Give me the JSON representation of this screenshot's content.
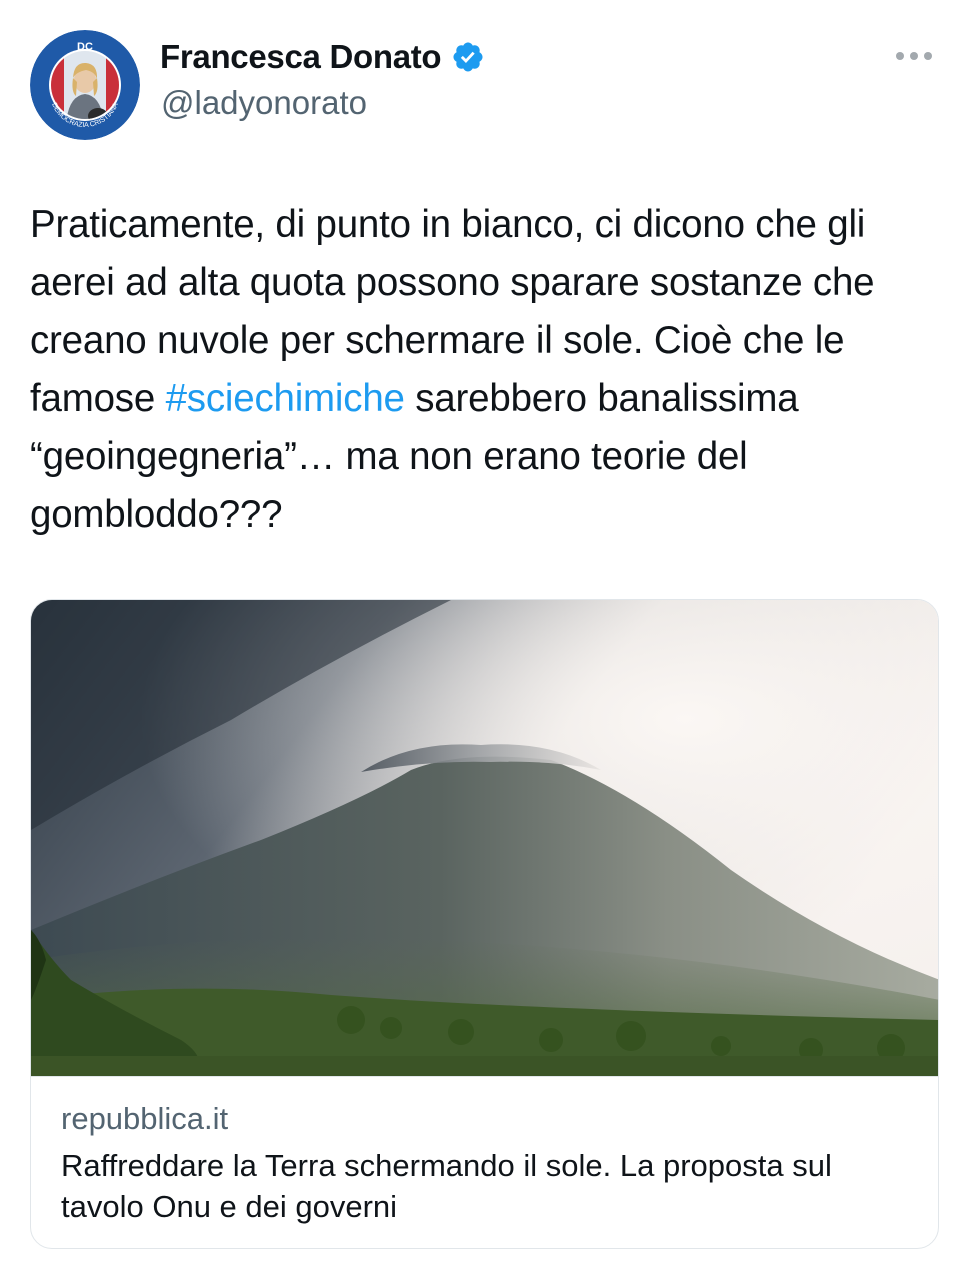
{
  "author": {
    "display_name": "Francesca Donato",
    "handle": "@ladyonorato",
    "avatar_badge_text": "DC",
    "avatar_ring_text": "DEMOCRAZIA CRISTIANA",
    "verified": true
  },
  "tweet": {
    "text_before_hashtag": "Praticamente, di punto in bianco, ci dicono che gli aerei ad alta quota possono sparare sostanze che creano nuvole per schermare il sole. Cioè che le famose ",
    "hashtag": "#sciechimiche",
    "text_after_hashtag": " sarebbero banalissima “geoingegneria”… ma non erano teorie del gombloddo???"
  },
  "link_card": {
    "image_description_icon": "volcano-photo",
    "domain": "repubblica.it",
    "title": "Raffreddare la Terra schermando il sole. La proposta sul tavolo Onu e dei governi"
  },
  "colors": {
    "link_blue": "#1d9bf0",
    "secondary_text": "#536471",
    "avatar_blue": "#1f5aa8"
  }
}
